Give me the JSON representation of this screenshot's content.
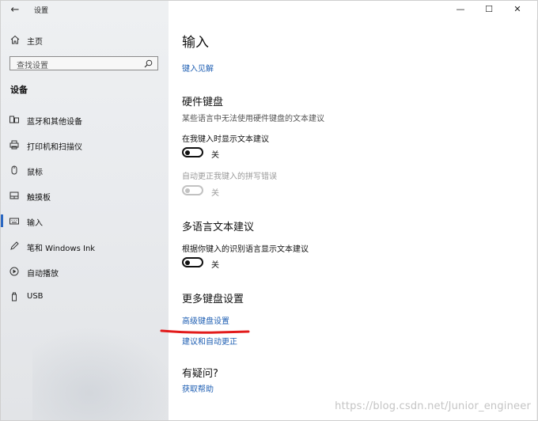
{
  "window": {
    "title": "设置",
    "back_glyph": "←",
    "controls": {
      "minimize": "—",
      "maximize": "☐",
      "close": "✕"
    }
  },
  "sidebar": {
    "home_label": "主页",
    "search_placeholder": "查找设置",
    "section_title": "设备",
    "items": [
      {
        "label": "蓝牙和其他设备",
        "icon": "bluetooth-devices-icon",
        "selected": false
      },
      {
        "label": "打印机和扫描仪",
        "icon": "printer-icon",
        "selected": false
      },
      {
        "label": "鼠标",
        "icon": "mouse-icon",
        "selected": false
      },
      {
        "label": "触摸板",
        "icon": "touchpad-icon",
        "selected": false
      },
      {
        "label": "输入",
        "icon": "keyboard-icon",
        "selected": true
      },
      {
        "label": "笔和 Windows Ink",
        "icon": "pen-icon",
        "selected": false
      },
      {
        "label": "自动播放",
        "icon": "autoplay-icon",
        "selected": false
      },
      {
        "label": "USB",
        "icon": "usb-icon",
        "selected": false
      }
    ]
  },
  "content": {
    "page_title": "输入",
    "typing_insights_link": "键入见解",
    "hardware_keyboard": {
      "title": "硬件键盘",
      "description": "某些语言中无法使用硬件键盘的文本建议",
      "show_suggestions_label": "在我键入时显示文本建议",
      "show_suggestions_state": "关",
      "autocorrect_label": "自动更正我键入的拼写错误",
      "autocorrect_state": "关"
    },
    "multilingual": {
      "title": "多语言文本建议",
      "label": "根据你键入的识别语言显示文本建议",
      "state": "关"
    },
    "more_keyboard": {
      "title": "更多键盘设置",
      "advanced_link": "高级键盘设置",
      "suggestions_link": "建议和自动更正"
    },
    "help": {
      "title": "有疑问?",
      "get_help_link": "获取帮助"
    }
  },
  "watermark": "https://blog.csdn.net/Junior_engineer",
  "colors": {
    "accent": "#1f5fb3",
    "selection": "#2b68c2",
    "annotation": "#e21b1b"
  }
}
